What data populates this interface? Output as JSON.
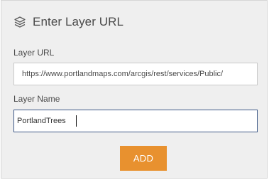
{
  "dialog": {
    "title": "Enter Layer URL",
    "icon": "layers-icon"
  },
  "layer_url": {
    "label": "Layer URL",
    "value": "https://www.portlandmaps.com/arcgis/rest/services/Public/"
  },
  "layer_name": {
    "label": "Layer Name",
    "value": "PortlandTrees"
  },
  "add_button": {
    "label": "ADD"
  },
  "colors": {
    "panel_background": "#efefef",
    "button_accent": "#e8912f",
    "focused_border": "#3f5a87",
    "text": "#4a4a4a"
  }
}
